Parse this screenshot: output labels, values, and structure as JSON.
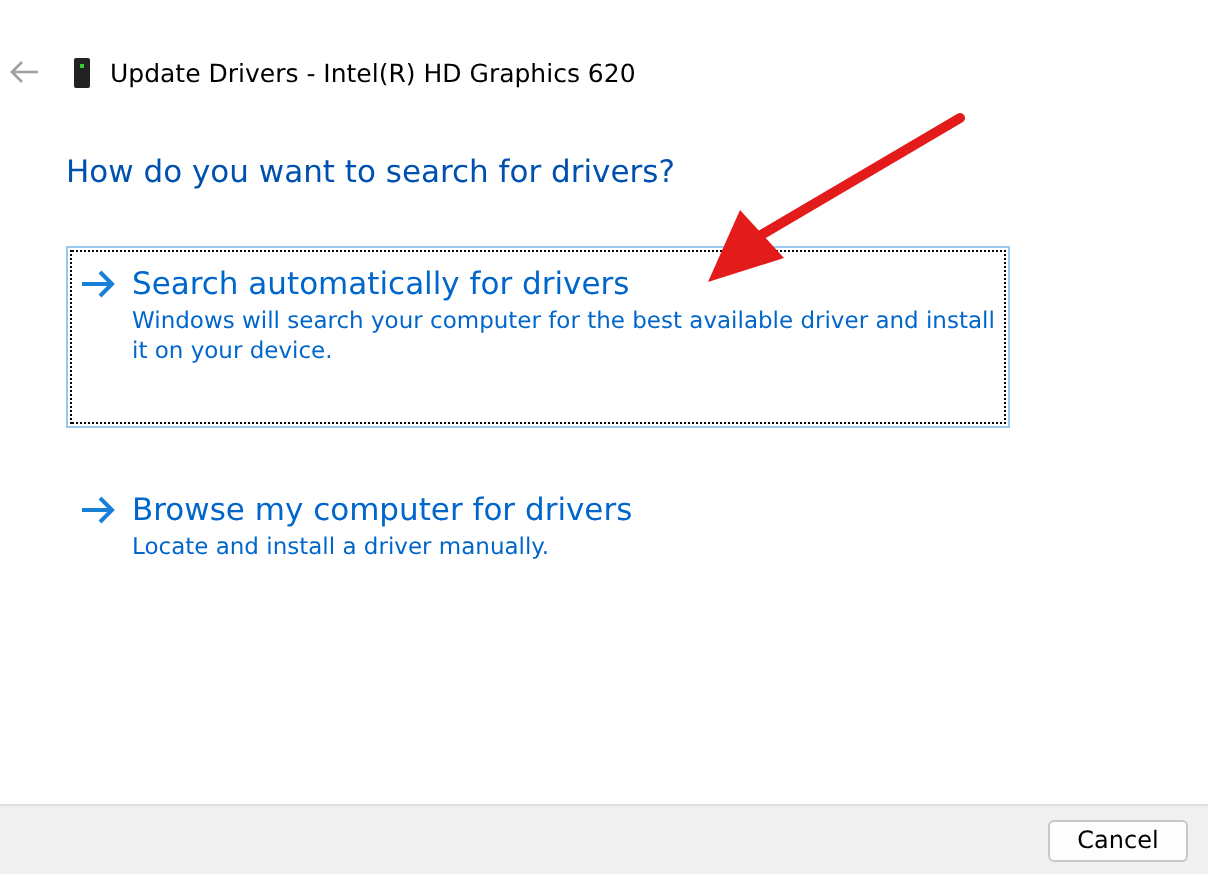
{
  "window": {
    "title": "Update Drivers - Intel(R) HD Graphics 620"
  },
  "heading": "How do you want to search for drivers?",
  "options": [
    {
      "title": "Search automatically for drivers",
      "description": "Windows will search your computer for the best available driver and install it on your device.",
      "selected": true
    },
    {
      "title": "Browse my computer for drivers",
      "description": "Locate and install a driver manually.",
      "selected": false
    }
  ],
  "annotation": {
    "kind": "arrow"
  },
  "buttons": [
    "Cancel"
  ]
}
